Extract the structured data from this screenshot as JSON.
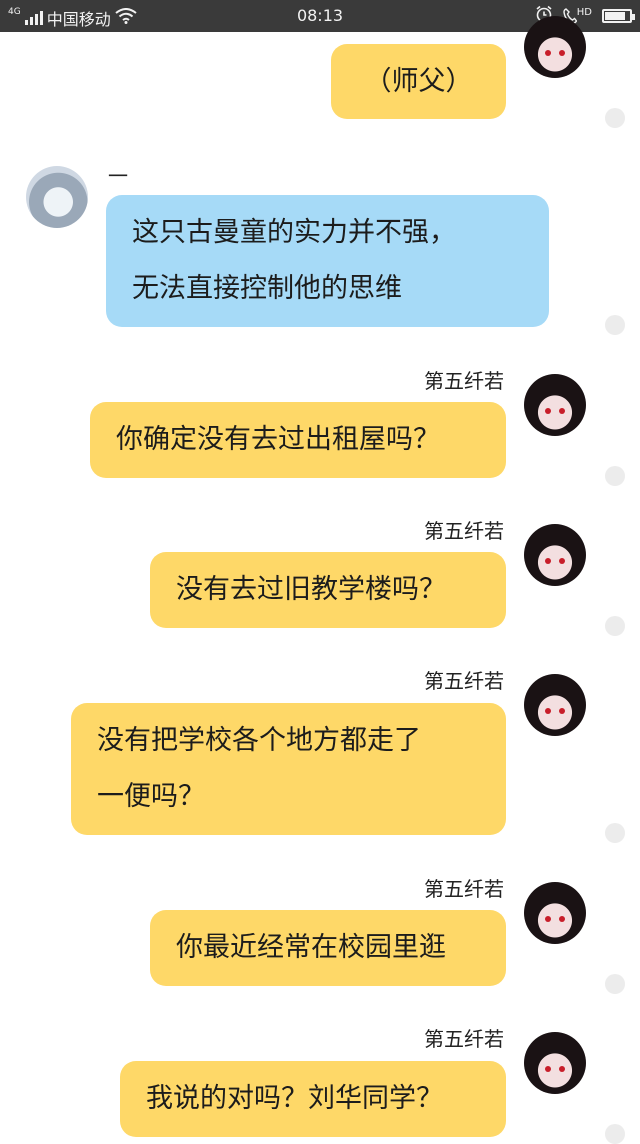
{
  "status_bar": {
    "network": "4G",
    "carrier": "中国移动",
    "time": "08:13",
    "hd": "HD",
    "battery_level": 0.9
  },
  "messages": [
    {
      "sender": "",
      "lines": [
        "（师父）"
      ],
      "side": "right",
      "color": "#fed868"
    },
    {
      "sender": "一",
      "lines": [
        "这只古曼童的实力并不强，",
        "无法直接控制他的思维"
      ],
      "side": "left",
      "color": "#a6daf7"
    },
    {
      "sender": "第五纤若",
      "lines": [
        "你确定没有去过出租屋吗？"
      ],
      "side": "right",
      "color": "#fed868"
    },
    {
      "sender": "第五纤若",
      "lines": [
        "没有去过旧教学楼吗？"
      ],
      "side": "right",
      "color": "#fed868"
    },
    {
      "sender": "第五纤若",
      "lines": [
        "没有把学校各个地方都走了",
        "一便吗？"
      ],
      "side": "right",
      "color": "#fed868"
    },
    {
      "sender": "第五纤若",
      "lines": [
        "你最近经常在校园里逛"
      ],
      "side": "right",
      "color": "#fed868"
    },
    {
      "sender": "第五纤若",
      "lines": [
        "我说的对吗？刘华同学？"
      ],
      "side": "right",
      "color": "#fed868"
    }
  ]
}
